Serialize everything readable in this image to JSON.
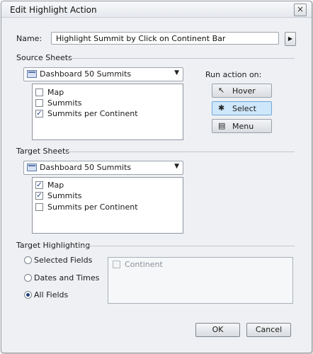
{
  "window": {
    "title": "Edit Highlight Action",
    "close_glyph": "×"
  },
  "name_field": {
    "label": "Name:",
    "value": "Highlight Summit by Click on Continent Bar",
    "arrow_icon": "play-arrow-icon"
  },
  "source": {
    "heading": "Source Sheets",
    "dropdown": {
      "value": "Dashboard 50 Summits",
      "icon": "dashboard-icon",
      "caret": "▼"
    },
    "sheets": [
      {
        "label": "Map",
        "checked": false
      },
      {
        "label": "Summits",
        "checked": false
      },
      {
        "label": "Summits per Continent",
        "checked": true
      }
    ]
  },
  "run_action": {
    "label": "Run action on:",
    "buttons": [
      {
        "label": "Hover",
        "icon": "pointer-icon",
        "selected": false
      },
      {
        "label": "Select",
        "icon": "click-pointer-icon",
        "selected": true
      },
      {
        "label": "Menu",
        "icon": "menu-icon",
        "selected": false
      }
    ]
  },
  "target": {
    "heading": "Target Sheets",
    "dropdown": {
      "value": "Dashboard 50 Summits",
      "icon": "dashboard-icon",
      "caret": "▼"
    },
    "sheets": [
      {
        "label": "Map",
        "checked": true
      },
      {
        "label": "Summits",
        "checked": true
      },
      {
        "label": "Summits per Continent",
        "checked": false
      }
    ]
  },
  "highlighting": {
    "heading": "Target Highlighting",
    "options": [
      {
        "label": "Selected Fields",
        "checked": false
      },
      {
        "label": "Dates and Times",
        "checked": false
      },
      {
        "label": "All Fields",
        "checked": true
      }
    ],
    "fields": [
      {
        "label": "Continent",
        "checked": false,
        "disabled": true
      }
    ]
  },
  "footer": {
    "ok": "OK",
    "cancel": "Cancel"
  },
  "check_glyph": "✓"
}
